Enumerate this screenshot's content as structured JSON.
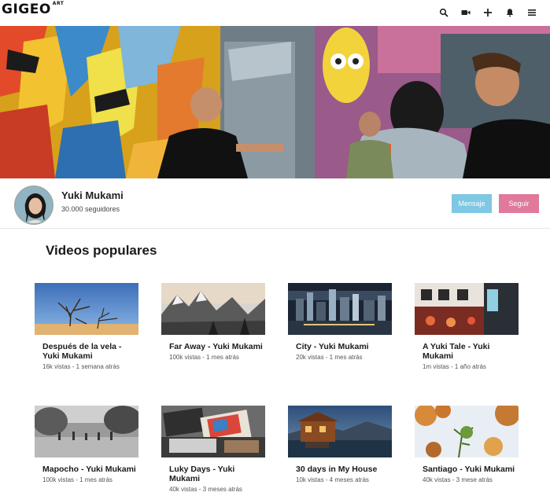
{
  "app": {
    "logo": "GIGEO",
    "logo_sup": "ART"
  },
  "nav": {
    "icons": [
      "search-icon",
      "video-camera-icon",
      "plus-icon",
      "bell-icon",
      "menu-icon"
    ]
  },
  "profile": {
    "name": "Yuki Mukami",
    "followers": "30.000 seguidores",
    "message_label": "Mensaje",
    "follow_label": "Seguir",
    "colors": {
      "message": "#7ec8e3",
      "follow": "#e0799a"
    }
  },
  "section": {
    "title": "Videos populares"
  },
  "videos": [
    {
      "title": "Después de la vela - Yuki Mukami",
      "meta": "16k vistas - 1 semana atrás"
    },
    {
      "title": "Far Away - Yuki Mukami",
      "meta": "100k vistas - 1 mes atrás"
    },
    {
      "title": "City - Yuki Mukami",
      "meta": "20k vistas - 1 mes atrás"
    },
    {
      "title": "A Yuki Tale - Yuki Mukami",
      "meta": "1m vistas - 1 año atrás"
    },
    {
      "title": "Mapocho - Yuki Mukami",
      "meta": "100k vistas - 1 mes atrás"
    },
    {
      "title": "Luky Days - Yuki Mukami",
      "meta": "40k vistas - 3 meses atrás"
    },
    {
      "title": "30 days in My House",
      "meta": "10k vistas - 4 meses atrás"
    },
    {
      "title": "Santiago - Yuki Mukami",
      "meta": "40k vistas - 3 mese atrás"
    }
  ]
}
